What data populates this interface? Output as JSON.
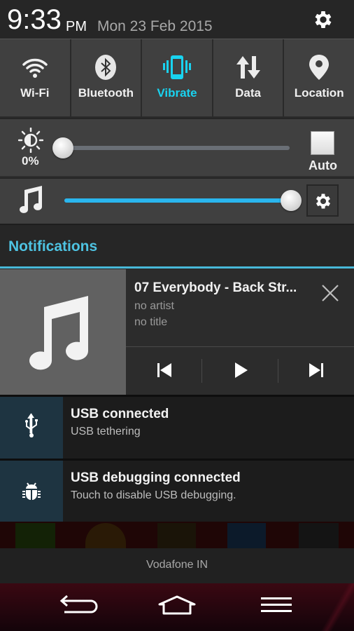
{
  "header": {
    "time": "9:33",
    "ampm": "PM",
    "date": "Mon 23 Feb 2015",
    "settings_icon": "gear-icon"
  },
  "quick_toggles": [
    {
      "label": "Wi-Fi",
      "icon": "wifi-icon",
      "active": false
    },
    {
      "label": "Bluetooth",
      "icon": "bluetooth-icon",
      "active": false
    },
    {
      "label": "Vibrate",
      "icon": "vibrate-icon",
      "active": true
    },
    {
      "label": "Data",
      "icon": "data-icon",
      "active": false
    },
    {
      "label": "Location",
      "icon": "location-icon",
      "active": false
    }
  ],
  "brightness": {
    "icon": "brightness-icon",
    "percent_label": "0%",
    "level_percent": 0,
    "auto_label": "Auto",
    "auto_checked": false
  },
  "volume": {
    "icon": "music-note-icon",
    "level_percent": 100,
    "settings_icon": "gear-icon"
  },
  "notifications": {
    "section_title": "Notifications",
    "media": {
      "title": "07 Everybody - Back Str...",
      "artist": "no artist",
      "track": "no title",
      "album_art_icon": "music-note-icon",
      "controls": [
        "previous",
        "play",
        "next"
      ]
    },
    "items": [
      {
        "title": "USB connected",
        "subtitle": "USB tethering",
        "icon": "usb-icon"
      },
      {
        "title": "USB debugging connected",
        "subtitle": "Touch to disable USB debugging.",
        "icon": "bug-icon"
      }
    ]
  },
  "carrier": "Vodafone IN",
  "colors": {
    "accent": "#19d3f0",
    "notifications_title": "#4ec3e2",
    "slider_fill": "#2ab6ee"
  }
}
